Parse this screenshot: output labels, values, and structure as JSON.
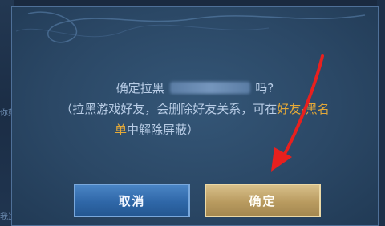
{
  "background": {
    "left_fragments": [
      "你剪",
      "我过"
    ]
  },
  "dialog": {
    "line1_prefix": "确定拉黑",
    "line1_suffix": "吗?",
    "line2_normal": "（拉黑游戏好友，会删除好友关系，可在",
    "line2_gold": "好友-黑名",
    "line3_gold": "单",
    "line3_normal": "中解除屏蔽）",
    "cancel_label": "取消",
    "confirm_label": "确定"
  },
  "colors": {
    "accent_gold": "#e5a938",
    "arrow": "#e8201e",
    "cancel_button": "#2f67a8",
    "confirm_button": "#b99b60"
  },
  "icons": [
    "arrow-annotation-icon"
  ]
}
